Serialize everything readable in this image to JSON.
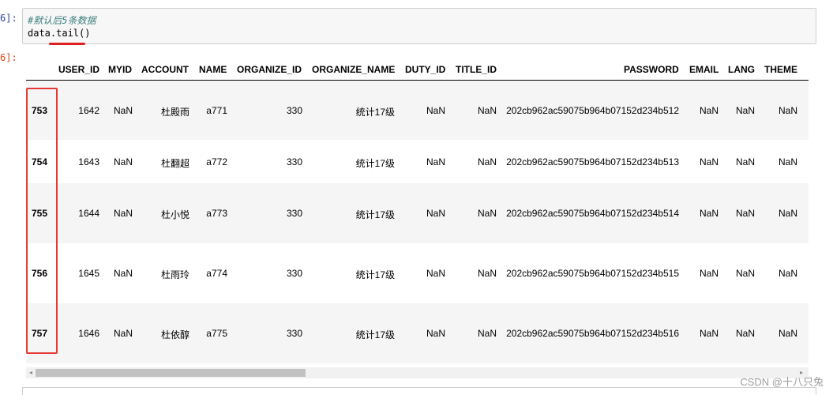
{
  "input_cell": {
    "prompt": "6]:",
    "comment": "#默认后5条数据",
    "code": "data.tail()"
  },
  "output_cell": {
    "prompt": "6]:"
  },
  "dataframe": {
    "columns": [
      "USER_ID",
      "MYID",
      "ACCOUNT",
      "NAME",
      "ORGANIZE_ID",
      "ORGANIZE_NAME",
      "DUTY_ID",
      "TITLE_ID",
      "PASSWORD",
      "EMAIL",
      "LANG",
      "THEME"
    ],
    "rows": [
      {
        "index": "753",
        "cells": [
          "1642",
          "NaN",
          "杜殿雨",
          "a771",
          "330",
          "统计17级",
          "NaN",
          "NaN",
          "202cb962ac59075b964b07152d234b512",
          "NaN",
          "NaN",
          "NaN"
        ]
      },
      {
        "index": "754",
        "cells": [
          "1643",
          "NaN",
          "杜翻超",
          "a772",
          "330",
          "统计17级",
          "NaN",
          "NaN",
          "202cb962ac59075b964b07152d234b513",
          "NaN",
          "NaN",
          "NaN"
        ]
      },
      {
        "index": "755",
        "cells": [
          "1644",
          "NaN",
          "杜小悦",
          "a773",
          "330",
          "统计17级",
          "NaN",
          "NaN",
          "202cb962ac59075b964b07152d234b514",
          "NaN",
          "NaN",
          "NaN"
        ]
      },
      {
        "index": "756",
        "cells": [
          "1645",
          "NaN",
          "杜雨玲",
          "a774",
          "330",
          "统计17级",
          "NaN",
          "NaN",
          "202cb962ac59075b964b07152d234b515",
          "NaN",
          "NaN",
          "NaN"
        ]
      },
      {
        "index": "757",
        "cells": [
          "1646",
          "NaN",
          "杜依醇",
          "a775",
          "330",
          "统计17级",
          "NaN",
          "NaN",
          "202cb962ac59075b964b07152d234b516",
          "NaN",
          "NaN",
          "NaN"
        ]
      }
    ]
  },
  "scrollbar": {
    "left_arrow_icon": "◂",
    "right_arrow_icon": "▸"
  },
  "watermark": "CSDN @十八只兔",
  "colors": {
    "highlight_red": "#e53935",
    "row_shade": "#f5f5f5",
    "comment": "#408080",
    "in_prompt": "#303f9f",
    "out_prompt": "#d84315"
  }
}
